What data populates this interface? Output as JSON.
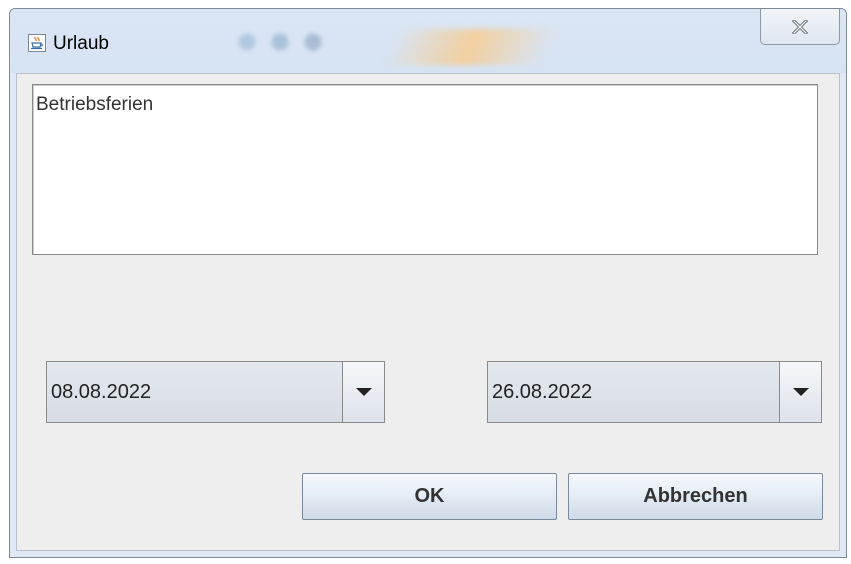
{
  "window": {
    "title": "Urlaub",
    "app_icon": "java-cup-icon",
    "close_icon": "close-x-icon"
  },
  "description": {
    "value": "Betriebsferien"
  },
  "date_from": {
    "value": "08.08.2022",
    "dropdown_icon": "chevron-down-icon"
  },
  "date_to": {
    "value": "26.08.2022",
    "dropdown_icon": "chevron-down-icon"
  },
  "buttons": {
    "ok_label": "OK",
    "cancel_label": "Abbrechen"
  }
}
